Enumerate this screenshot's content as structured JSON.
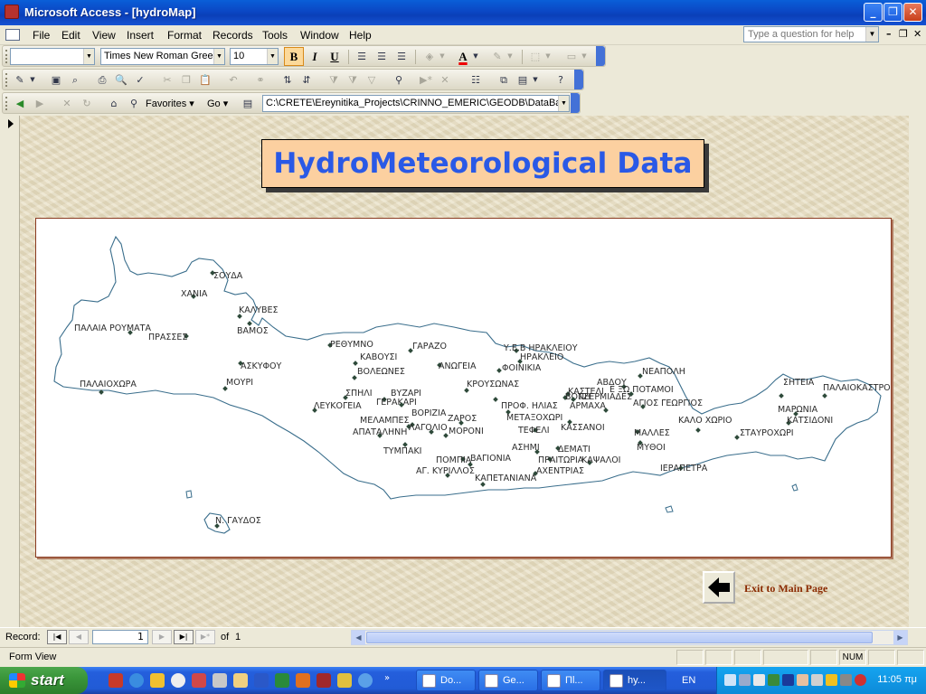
{
  "window": {
    "title": "Microsoft Access - [hydroMap]",
    "min_label": "_",
    "max_label": "❐",
    "close_label": "✕"
  },
  "menu": {
    "items": [
      "File",
      "Edit",
      "View",
      "Insert",
      "Format",
      "Records",
      "Tools",
      "Window",
      "Help"
    ],
    "help_placeholder": "Type a question for help"
  },
  "toolbar_format": {
    "object_value": "",
    "font_name": "Times New Roman Greek",
    "font_size": "10",
    "bold_label": "B",
    "italic_label": "I",
    "underline_label": "U"
  },
  "toolbar_web": {
    "favorites_label": "Favorites",
    "go_label": "Go",
    "address": "C:\\CRETE\\Ereynitika_Projects\\CRINNO_EMERIC\\GEODB\\DataBase"
  },
  "form": {
    "title": "HydroMeteorological Data",
    "exit_label": "Exit to Main Page",
    "stations": [
      {
        "name": "ΣΟΥΔΑ"
      },
      {
        "name": "ΧΑΝΙΑ"
      },
      {
        "name": "ΚΑΛΥΒΕΣ"
      },
      {
        "name": "ΒΑΜΟΣ"
      },
      {
        "name": "ΠΑΛΑΙΑ ΡΟΥΜΑΤΑ"
      },
      {
        "name": "ΠΡΑΣΣΕΣ"
      },
      {
        "name": "ΑΣΚΥΦΟΥ"
      },
      {
        "name": "ΜΟΥΡΙ"
      },
      {
        "name": "ΠΑΛΑΙΟΧΩΡΑ"
      },
      {
        "name": "Ν. ΓΑΥΔΟΣ"
      },
      {
        "name": "ΡΕΘΥΜΝΟ"
      },
      {
        "name": "ΓΑΡΑΖΟ"
      },
      {
        "name": "ΚΑΒΟΥΣΙ"
      },
      {
        "name": "ΒΟΛΕΩΝΕΣ"
      },
      {
        "name": "ΑΝΩΓΕΙΑ"
      },
      {
        "name": "ΣΠΗΛΙ"
      },
      {
        "name": "ΓΕΡΑΚΑΡΙ"
      },
      {
        "name": "ΒΥΖΑΡΙ"
      },
      {
        "name": "ΛΕΥΚΟΓΕΙΑ"
      },
      {
        "name": "ΜΕΛΑΜΠΕΣ"
      },
      {
        "name": "ΑΠΑΤΑΛΗΝΗ"
      },
      {
        "name": "ΒΟΡΙΖΙΑ"
      },
      {
        "name": "ΛΑΓΟΛΙΟ"
      },
      {
        "name": "ΖΑΡΟΣ"
      },
      {
        "name": "ΜΟΡΟΝΙ"
      },
      {
        "name": "ΤΥΜΠΑΚΙ"
      },
      {
        "name": "ΠΟΜΠΙΑ"
      },
      {
        "name": "ΒΑΓΙΟΝΙΑ"
      },
      {
        "name": "ΑΓ. ΚΥΡΙΛΛΟΣ"
      },
      {
        "name": "ΚΑΠΕΤΑΝΙΑΝΑ"
      },
      {
        "name": "ΚΡΟΥΣΩΝΑΣ"
      },
      {
        "name": "Υ.Ε.Β ΗΡΑΚΛΕΙΟΥ"
      },
      {
        "name": "ΗΡΑΚΛΕΙΟ"
      },
      {
        "name": "ΦΟΙΝΙΚΙΑ"
      },
      {
        "name": "ΠΡΟΦ. ΗΛΙΑΣ"
      },
      {
        "name": "ΜΕΤΑΞΟΧΩΡΙ"
      },
      {
        "name": "ΤΕΦΕΛΙ"
      },
      {
        "name": "ΑΣΗΜΙ"
      },
      {
        "name": "ΠΡΑΙΤΩΡΙΑ"
      },
      {
        "name": "ΑΧΕΝΤΡΙΑΣ"
      },
      {
        "name": "ΔΕΜΑΤΙ"
      },
      {
        "name": "ΚΑΣΣΑΝΟΙ"
      },
      {
        "name": "ΚΑΣΤΕΛΙ"
      },
      {
        "name": "ΒΟΝΗ"
      },
      {
        "name": "ΤΖΕΡΜΙΑΔΕΣ"
      },
      {
        "name": "ΑΡΜΑΧΑ"
      },
      {
        "name": "ΑΒΔΟΥ"
      },
      {
        "name": "Ε ΞΩ ΠΟΤΑΜΟΙ"
      },
      {
        "name": "ΑΓΙΟΣ ΓΕΩΡΓΙΟΣ"
      },
      {
        "name": "ΝΕΑΠΟΛΗ"
      },
      {
        "name": "ΚΑΨΑΛΟΙ"
      },
      {
        "name": "ΜΑΛΛΕΣ"
      },
      {
        "name": "ΜΥΘΟΙ"
      },
      {
        "name": "ΙΕΡΑΠΕΤΡΑ"
      },
      {
        "name": "ΚΑΛΟ ΧΩΡΙΟ"
      },
      {
        "name": "ΣΤΑΥΡΟΧΩΡΙ"
      },
      {
        "name": "ΣΗΤΕΙΑ"
      },
      {
        "name": "ΠΑΛΑΙΟΚΑΣΤΡΟ"
      },
      {
        "name": "ΜΑΡΩΝΙΑ"
      },
      {
        "name": "ΚΑΤΣΙΔΟΝΙ"
      }
    ]
  },
  "record_nav": {
    "record_label": "Record:",
    "current": "1",
    "of_label": "of",
    "total": "1"
  },
  "status": {
    "view": "Form View",
    "num": "NUM"
  },
  "taskbar": {
    "start_label": "start",
    "tasks": [
      "Do...",
      "Ge...",
      "Πl...",
      "hy..."
    ],
    "lang": "EN",
    "clock": "11:05 πμ"
  }
}
